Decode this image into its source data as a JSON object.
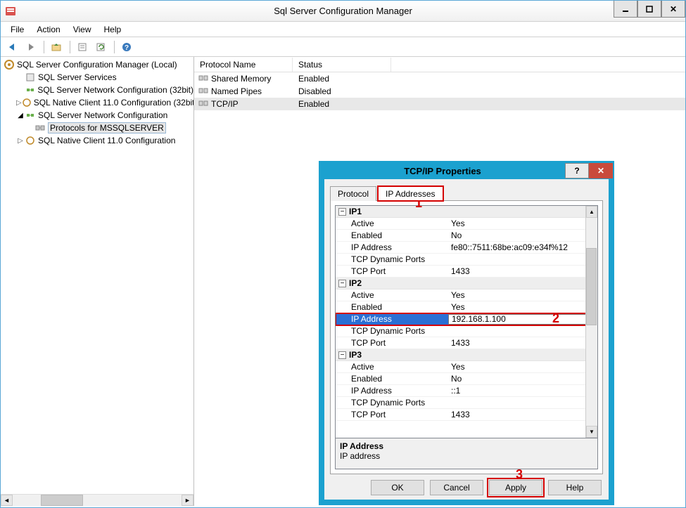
{
  "window": {
    "title": "Sql Server Configuration Manager"
  },
  "menu": {
    "file": "File",
    "action": "Action",
    "view": "View",
    "help": "Help"
  },
  "tree": {
    "root": "SQL Server Configuration Manager (Local)",
    "n1": "SQL Server Services",
    "n2": "SQL Server Network Configuration (32bit)",
    "n3": "SQL Native Client 11.0 Configuration (32bit)",
    "n4": "SQL Server Network Configuration",
    "n4a": "Protocols for MSSQLSERVER",
    "n5": "SQL Native Client 11.0 Configuration"
  },
  "list": {
    "head_name": "Protocol Name",
    "head_status": "Status",
    "rows": [
      {
        "name": "Shared Memory",
        "status": "Enabled"
      },
      {
        "name": "Named Pipes",
        "status": "Disabled"
      },
      {
        "name": "TCP/IP",
        "status": "Enabled"
      }
    ]
  },
  "dialog": {
    "title": "TCP/IP Properties",
    "tab_protocol": "Protocol",
    "tab_ip": "IP Addresses",
    "groups": {
      "ip1": {
        "label": "IP1",
        "active": "Yes",
        "enabled": "No",
        "addr": "fe80::7511:68be:ac09:e34f%12",
        "dyn": "",
        "port": "1433"
      },
      "ip2": {
        "label": "IP2",
        "active": "Yes",
        "enabled": "Yes",
        "addr": "192.168.1.100",
        "dyn": "",
        "port": "1433"
      },
      "ip3": {
        "label": "IP3",
        "active": "Yes",
        "enabled": "No",
        "addr": "::1",
        "dyn": "",
        "port": "1433"
      }
    },
    "keys": {
      "active": "Active",
      "enabled": "Enabled",
      "addr": "IP Address",
      "dyn": "TCP Dynamic Ports",
      "port": "TCP Port"
    },
    "desc_h": "IP Address",
    "desc_t": "IP address",
    "btn_ok": "OK",
    "btn_cancel": "Cancel",
    "btn_apply": "Apply",
    "btn_help": "Help"
  },
  "annotations": {
    "a1": "1",
    "a2": "2",
    "a3": "3"
  }
}
